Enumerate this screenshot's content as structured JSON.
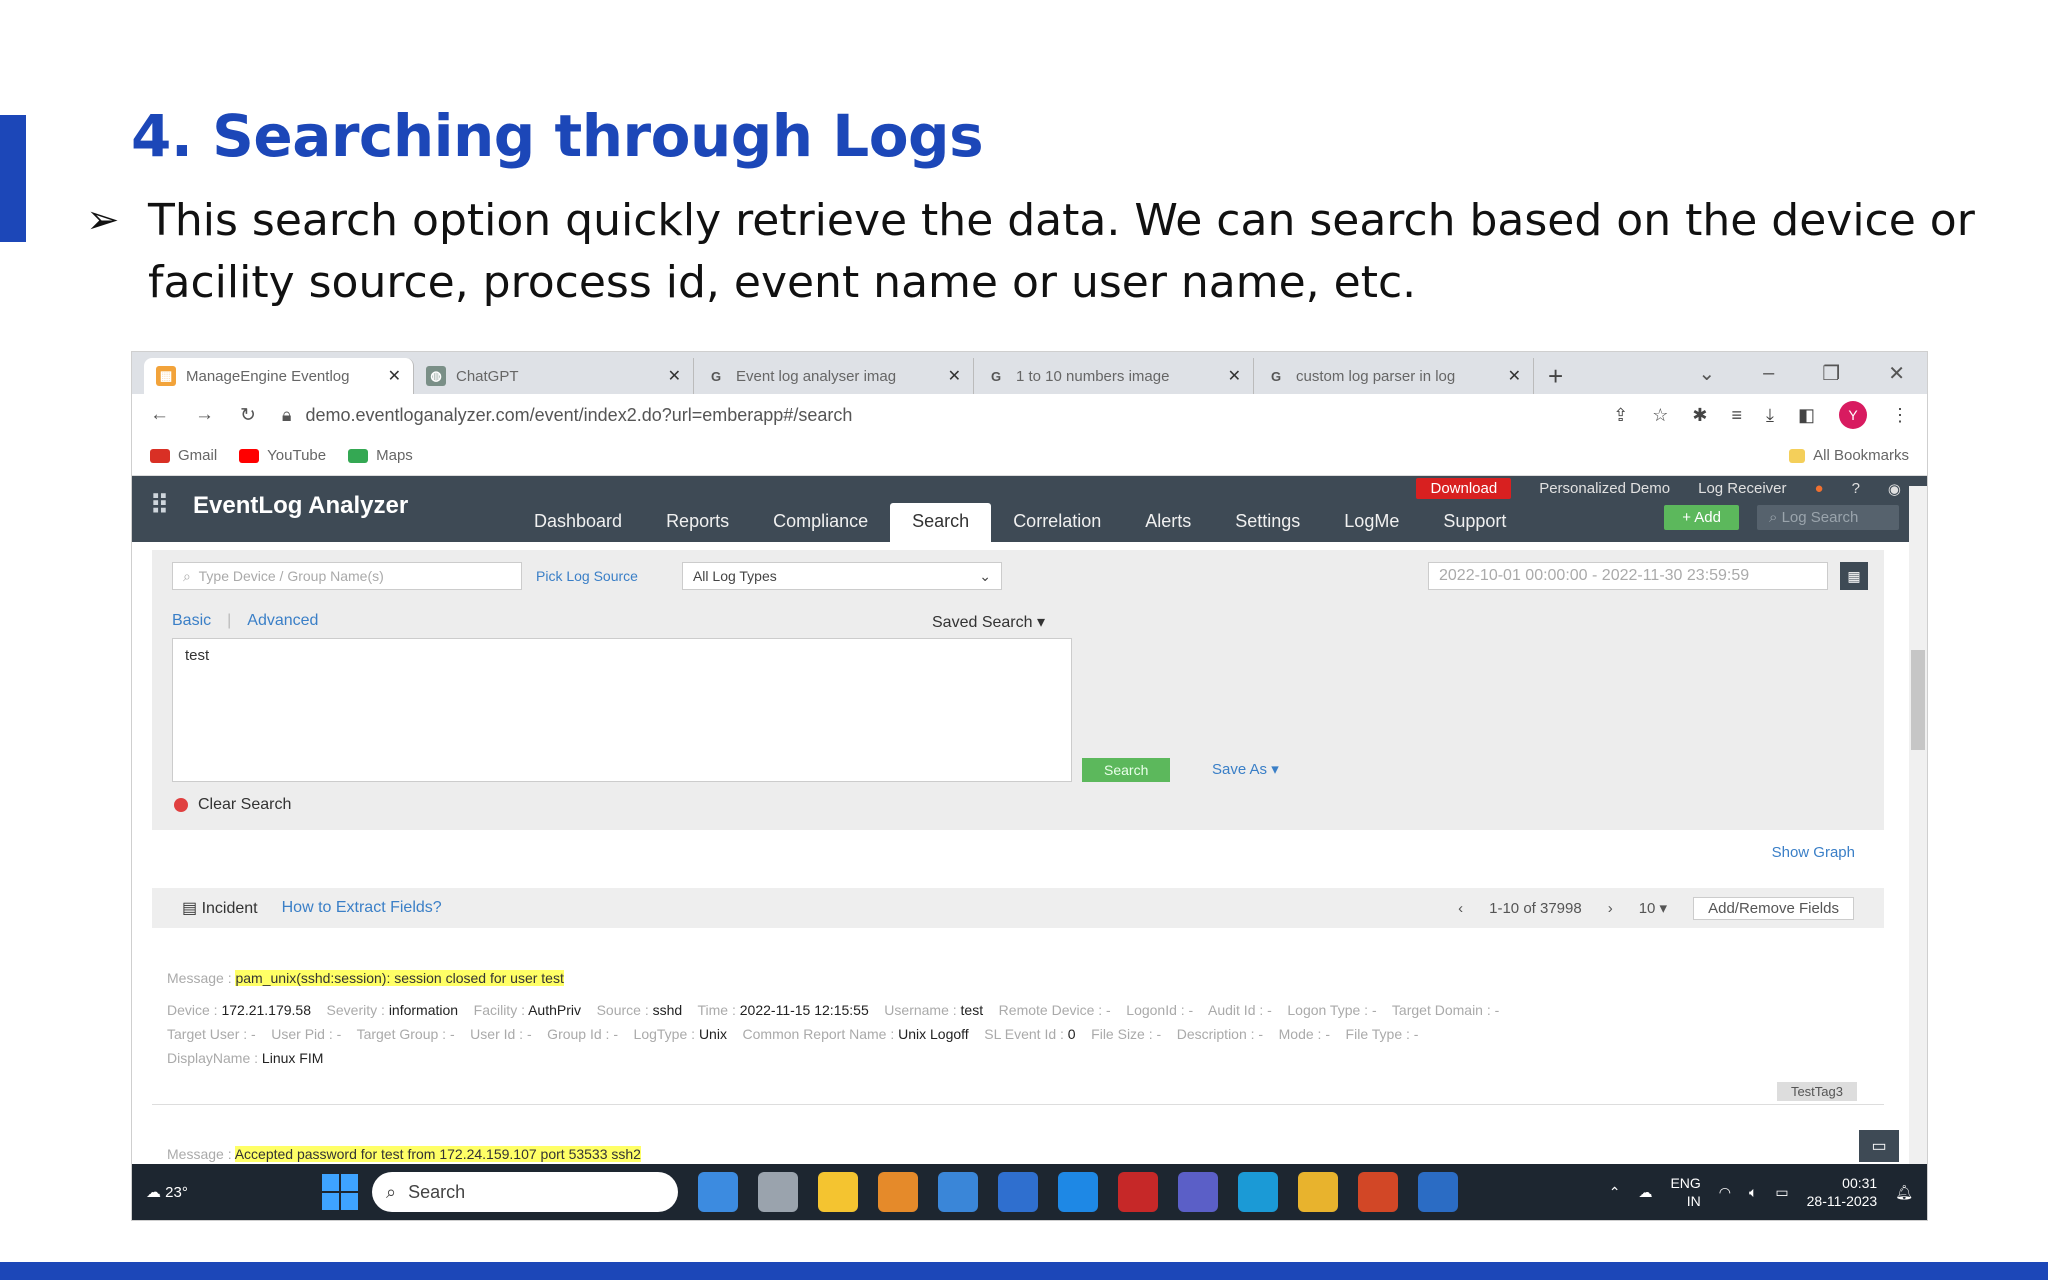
{
  "slide": {
    "title": "4. Searching through Logs",
    "bullet": "This search option quickly retrieve the data. We can search based on the device or facility source, process id, event name or user name, etc."
  },
  "browser": {
    "tabs": [
      {
        "label": "ManageEngine Eventlog",
        "icon": "eventlog-icon",
        "color": "#f2a33a",
        "active": true
      },
      {
        "label": "ChatGPT",
        "icon": "chatgpt-icon",
        "color": "#7a8f87",
        "active": false
      },
      {
        "label": "Event log analyser imag",
        "icon": "google-icon",
        "color": "#4285f4",
        "active": false
      },
      {
        "label": "1 to 10 numbers image",
        "icon": "google-icon",
        "color": "#4285f4",
        "active": false
      },
      {
        "label": "custom log parser in log",
        "icon": "google-icon",
        "color": "#4285f4",
        "active": false
      }
    ],
    "url": "demo.eventloganalyzer.com/event/index2.do?url=emberapp#/search",
    "bookmarks": [
      {
        "label": "Gmail",
        "color": "#d93025"
      },
      {
        "label": "YouTube",
        "color": "#ff0000"
      },
      {
        "label": "Maps",
        "color": "#34a853"
      }
    ],
    "all_bookmarks": "All Bookmarks",
    "avatar_letter": "Y"
  },
  "app": {
    "brand": "EventLog Analyzer",
    "nav": [
      "Dashboard",
      "Reports",
      "Compliance",
      "Search",
      "Correlation",
      "Alerts",
      "Settings",
      "LogMe",
      "Support"
    ],
    "active_nav": "Search",
    "top_links": {
      "download": "Download",
      "demo": "Personalized Demo",
      "receiver": "Log Receiver",
      "help": "?"
    },
    "add": "+ Add",
    "log_search": "Log Search"
  },
  "search": {
    "device_placeholder": "Type Device / Group Name(s)",
    "pick_source": "Pick Log Source",
    "log_types": "All Log Types",
    "date_range": "2022-10-01 00:00:00 - 2022-11-30 23:59:59",
    "tab_basic": "Basic",
    "tab_advanced": "Advanced",
    "saved_search": "Saved Search",
    "query": "test",
    "search_btn": "Search",
    "save_as": "Save As",
    "clear": "Clear Search"
  },
  "results": {
    "show_graph": "Show Graph",
    "incident": "Incident",
    "extract": "How to Extract Fields?",
    "range": "1-10 of 37998",
    "per_page": "10",
    "add_remove": "Add/Remove Fields",
    "record1": {
      "message": "pam_unix(sshd:session): session closed for user test",
      "device": "172.21.179.58",
      "severity": "information",
      "facility": "AuthPriv",
      "source": "sshd",
      "time": "2022-11-15 12:15:55",
      "username": "test",
      "logtype": "Unix",
      "report": "Unix Logoff",
      "sl_event": "0",
      "display": "Linux FIM",
      "tag": "TestTag3"
    },
    "record2_message": "Accepted password for test from 172.24.159.107 port 53533 ssh2"
  },
  "taskbar": {
    "weather": "23°",
    "search": "Search",
    "lang": "ENG",
    "region": "IN",
    "time": "00:31",
    "date": "28-11-2023"
  }
}
